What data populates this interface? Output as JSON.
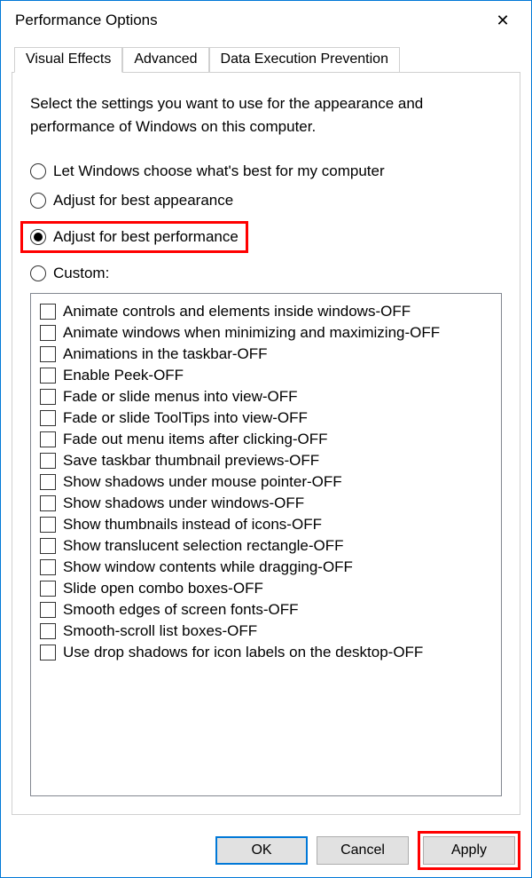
{
  "window": {
    "title": "Performance Options"
  },
  "tabs": [
    {
      "label": "Visual Effects",
      "active": true
    },
    {
      "label": "Advanced",
      "active": false
    },
    {
      "label": "Data Execution Prevention",
      "active": false
    }
  ],
  "description": "Select the settings you want to use for the appearance and performance of Windows on this computer.",
  "radios": [
    {
      "label": "Let Windows choose what's best for my computer",
      "selected": false,
      "highlighted": false
    },
    {
      "label": "Adjust for best appearance",
      "selected": false,
      "highlighted": false
    },
    {
      "label": "Adjust for best performance",
      "selected": true,
      "highlighted": true
    },
    {
      "label": "Custom:",
      "selected": false,
      "highlighted": false
    }
  ],
  "checkboxes": [
    {
      "label": "Animate controls and elements inside windows-OFF",
      "checked": false
    },
    {
      "label": "Animate windows when minimizing and maximizing-OFF",
      "checked": false
    },
    {
      "label": "Animations in the taskbar-OFF",
      "checked": false
    },
    {
      "label": "Enable Peek-OFF",
      "checked": false
    },
    {
      "label": "Fade or slide menus into view-OFF",
      "checked": false
    },
    {
      "label": "Fade or slide ToolTips into view-OFF",
      "checked": false
    },
    {
      "label": "Fade out menu items after clicking-OFF",
      "checked": false
    },
    {
      "label": "Save taskbar thumbnail previews-OFF",
      "checked": false
    },
    {
      "label": "Show shadows under mouse pointer-OFF",
      "checked": false
    },
    {
      "label": "Show shadows under windows-OFF",
      "checked": false
    },
    {
      "label": "Show thumbnails instead of icons-OFF",
      "checked": false
    },
    {
      "label": "Show translucent selection rectangle-OFF",
      "checked": false
    },
    {
      "label": "Show window contents while dragging-OFF",
      "checked": false
    },
    {
      "label": "Slide open combo boxes-OFF",
      "checked": false
    },
    {
      "label": "Smooth edges of screen fonts-OFF",
      "checked": false
    },
    {
      "label": "Smooth-scroll list boxes-OFF",
      "checked": false
    },
    {
      "label": "Use drop shadows for icon labels on the desktop-OFF",
      "checked": false
    }
  ],
  "buttons": {
    "ok": "OK",
    "cancel": "Cancel",
    "apply": "Apply"
  }
}
